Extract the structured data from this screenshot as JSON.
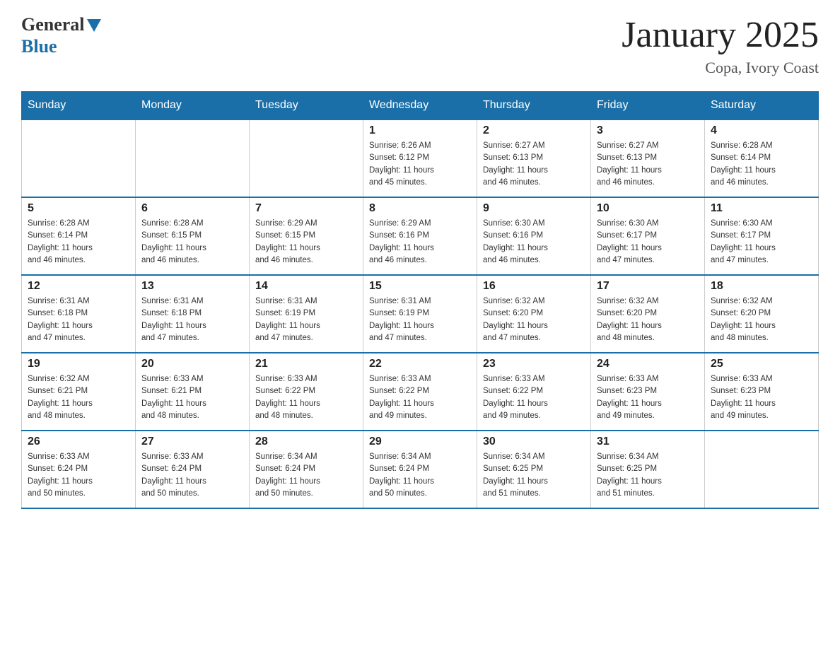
{
  "header": {
    "logo_general": "General",
    "logo_blue": "Blue",
    "title": "January 2025",
    "subtitle": "Copa, Ivory Coast"
  },
  "days_of_week": [
    "Sunday",
    "Monday",
    "Tuesday",
    "Wednesday",
    "Thursday",
    "Friday",
    "Saturday"
  ],
  "weeks": [
    [
      {
        "day": "",
        "info": ""
      },
      {
        "day": "",
        "info": ""
      },
      {
        "day": "",
        "info": ""
      },
      {
        "day": "1",
        "info": "Sunrise: 6:26 AM\nSunset: 6:12 PM\nDaylight: 11 hours\nand 45 minutes."
      },
      {
        "day": "2",
        "info": "Sunrise: 6:27 AM\nSunset: 6:13 PM\nDaylight: 11 hours\nand 46 minutes."
      },
      {
        "day": "3",
        "info": "Sunrise: 6:27 AM\nSunset: 6:13 PM\nDaylight: 11 hours\nand 46 minutes."
      },
      {
        "day": "4",
        "info": "Sunrise: 6:28 AM\nSunset: 6:14 PM\nDaylight: 11 hours\nand 46 minutes."
      }
    ],
    [
      {
        "day": "5",
        "info": "Sunrise: 6:28 AM\nSunset: 6:14 PM\nDaylight: 11 hours\nand 46 minutes."
      },
      {
        "day": "6",
        "info": "Sunrise: 6:28 AM\nSunset: 6:15 PM\nDaylight: 11 hours\nand 46 minutes."
      },
      {
        "day": "7",
        "info": "Sunrise: 6:29 AM\nSunset: 6:15 PM\nDaylight: 11 hours\nand 46 minutes."
      },
      {
        "day": "8",
        "info": "Sunrise: 6:29 AM\nSunset: 6:16 PM\nDaylight: 11 hours\nand 46 minutes."
      },
      {
        "day": "9",
        "info": "Sunrise: 6:30 AM\nSunset: 6:16 PM\nDaylight: 11 hours\nand 46 minutes."
      },
      {
        "day": "10",
        "info": "Sunrise: 6:30 AM\nSunset: 6:17 PM\nDaylight: 11 hours\nand 47 minutes."
      },
      {
        "day": "11",
        "info": "Sunrise: 6:30 AM\nSunset: 6:17 PM\nDaylight: 11 hours\nand 47 minutes."
      }
    ],
    [
      {
        "day": "12",
        "info": "Sunrise: 6:31 AM\nSunset: 6:18 PM\nDaylight: 11 hours\nand 47 minutes."
      },
      {
        "day": "13",
        "info": "Sunrise: 6:31 AM\nSunset: 6:18 PM\nDaylight: 11 hours\nand 47 minutes."
      },
      {
        "day": "14",
        "info": "Sunrise: 6:31 AM\nSunset: 6:19 PM\nDaylight: 11 hours\nand 47 minutes."
      },
      {
        "day": "15",
        "info": "Sunrise: 6:31 AM\nSunset: 6:19 PM\nDaylight: 11 hours\nand 47 minutes."
      },
      {
        "day": "16",
        "info": "Sunrise: 6:32 AM\nSunset: 6:20 PM\nDaylight: 11 hours\nand 47 minutes."
      },
      {
        "day": "17",
        "info": "Sunrise: 6:32 AM\nSunset: 6:20 PM\nDaylight: 11 hours\nand 48 minutes."
      },
      {
        "day": "18",
        "info": "Sunrise: 6:32 AM\nSunset: 6:20 PM\nDaylight: 11 hours\nand 48 minutes."
      }
    ],
    [
      {
        "day": "19",
        "info": "Sunrise: 6:32 AM\nSunset: 6:21 PM\nDaylight: 11 hours\nand 48 minutes."
      },
      {
        "day": "20",
        "info": "Sunrise: 6:33 AM\nSunset: 6:21 PM\nDaylight: 11 hours\nand 48 minutes."
      },
      {
        "day": "21",
        "info": "Sunrise: 6:33 AM\nSunset: 6:22 PM\nDaylight: 11 hours\nand 48 minutes."
      },
      {
        "day": "22",
        "info": "Sunrise: 6:33 AM\nSunset: 6:22 PM\nDaylight: 11 hours\nand 49 minutes."
      },
      {
        "day": "23",
        "info": "Sunrise: 6:33 AM\nSunset: 6:22 PM\nDaylight: 11 hours\nand 49 minutes."
      },
      {
        "day": "24",
        "info": "Sunrise: 6:33 AM\nSunset: 6:23 PM\nDaylight: 11 hours\nand 49 minutes."
      },
      {
        "day": "25",
        "info": "Sunrise: 6:33 AM\nSunset: 6:23 PM\nDaylight: 11 hours\nand 49 minutes."
      }
    ],
    [
      {
        "day": "26",
        "info": "Sunrise: 6:33 AM\nSunset: 6:24 PM\nDaylight: 11 hours\nand 50 minutes."
      },
      {
        "day": "27",
        "info": "Sunrise: 6:33 AM\nSunset: 6:24 PM\nDaylight: 11 hours\nand 50 minutes."
      },
      {
        "day": "28",
        "info": "Sunrise: 6:34 AM\nSunset: 6:24 PM\nDaylight: 11 hours\nand 50 minutes."
      },
      {
        "day": "29",
        "info": "Sunrise: 6:34 AM\nSunset: 6:24 PM\nDaylight: 11 hours\nand 50 minutes."
      },
      {
        "day": "30",
        "info": "Sunrise: 6:34 AM\nSunset: 6:25 PM\nDaylight: 11 hours\nand 51 minutes."
      },
      {
        "day": "31",
        "info": "Sunrise: 6:34 AM\nSunset: 6:25 PM\nDaylight: 11 hours\nand 51 minutes."
      },
      {
        "day": "",
        "info": ""
      }
    ]
  ]
}
